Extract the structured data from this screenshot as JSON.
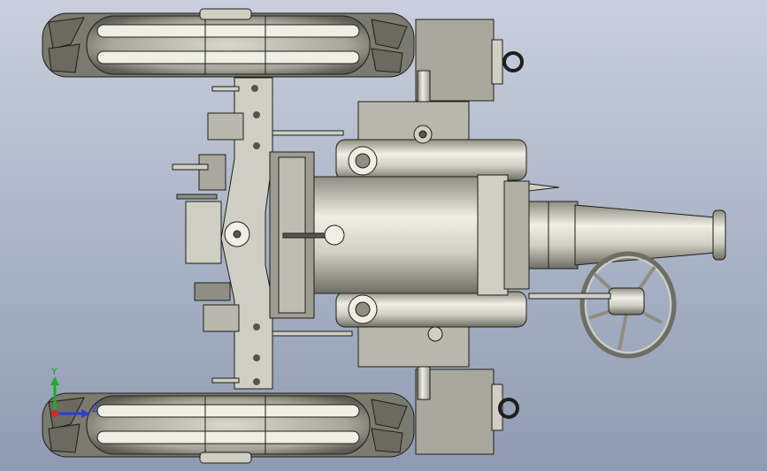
{
  "viewport": {
    "background_top": "#c9cfdc",
    "background_bottom": "#8f9bb3",
    "model_fill": "#cfcfc3",
    "model_shade": "#8e8e82",
    "model_dark": "#55554d",
    "model_light": "#efefe6",
    "edge_color": "#1e1e1a"
  },
  "triad": {
    "x_axis": {
      "label": "",
      "color": "#d42a1e"
    },
    "y_axis": {
      "label": "Y",
      "color": "#1faa2a"
    },
    "z_axis": {
      "label": "Z",
      "color": "#2a3fd4"
    }
  }
}
